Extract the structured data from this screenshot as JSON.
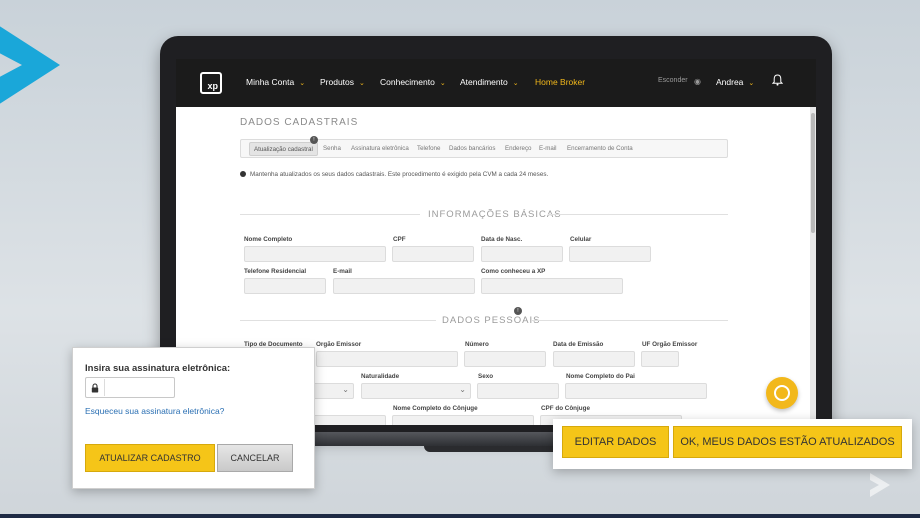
{
  "colors": {
    "accent": "#f5c518",
    "navbar": "#1b1b1b",
    "link": "#2a6fb3"
  },
  "nav": {
    "brand": "xp",
    "items": [
      {
        "label": "Minha Conta"
      },
      {
        "label": "Produtos"
      },
      {
        "label": "Conhecimento"
      },
      {
        "label": "Atendimento"
      }
    ],
    "home_broker": "Home Broker",
    "hide_label": "Esconder",
    "user_name": "Andrea"
  },
  "page": {
    "title": "DADOS CADASTRAIS",
    "tabs": [
      "Atualização cadastral",
      "Senha",
      "Assinatura eletrônica",
      "Telefone",
      "Dados bancários",
      "Endereço",
      "E-mail",
      "Encerramento de Conta"
    ],
    "tab_badge": "!",
    "notice": "Mantenha atualizados os seus dados cadastrais. Este procedimento é exigido pela CVM a cada 24 meses.",
    "section_basic": "INFORMAÇÕES BÁSICAS",
    "section_personal": "DADOS PESSOAIS",
    "section_badge": "!",
    "basic_fields": {
      "nome_completo": "Nome Completo",
      "cpf": "CPF",
      "data_nasc": "Data de Nasc.",
      "celular": "Celular",
      "telefone_residencial": "Telefone Residencial",
      "email": "E-mail",
      "como_conheceu": "Como conheceu a XP"
    },
    "personal_fields": {
      "tipo_documento": "Tipo de Documento",
      "orgao_emissor": "Orgão Emissor",
      "numero": "Número",
      "data_emissao": "Data de Emissão",
      "uf_orgao_emissor": "UF Orgão Emissor",
      "naturalidade": "Naturalidade",
      "sexo": "Sexo",
      "nome_pai": "Nome Completo do Pai",
      "nome_conjuge": "Nome Completo do Cônjuge",
      "cpf_conjuge": "CPF do Cônjuge"
    }
  },
  "signature_dialog": {
    "title": "Insira sua assinatura eletrônica:",
    "input_value": "",
    "forgot_link": "Esqueceu sua assinatura eletrônica?",
    "update_button": "ATUALIZAR CADASTRO",
    "cancel_button": "CANCELAR"
  },
  "confirm_bar": {
    "edit_button": "EDITAR DADOS",
    "ok_button": "OK, MEUS DADOS ESTÃO ATUALIZADOS"
  }
}
